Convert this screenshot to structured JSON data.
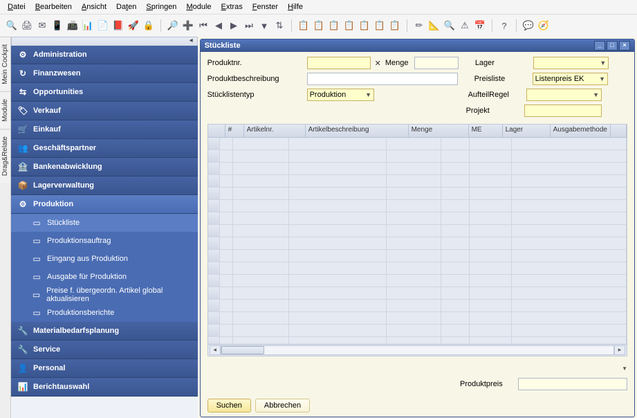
{
  "menu": [
    "Datei",
    "Bearbeiten",
    "Ansicht",
    "Daten",
    "Springen",
    "Module",
    "Extras",
    "Fenster",
    "Hilfe"
  ],
  "cockpit_tabs": [
    "Mein Cockpit",
    "Module",
    "Drag&Relate"
  ],
  "nav": [
    {
      "icon": "⚙",
      "label": "Administration"
    },
    {
      "icon": "↻",
      "label": "Finanzwesen"
    },
    {
      "icon": "⇆",
      "label": "Opportunities"
    },
    {
      "icon": "🏷",
      "label": "Verkauf"
    },
    {
      "icon": "🛒",
      "label": "Einkauf"
    },
    {
      "icon": "👥",
      "label": "Geschäftspartner"
    },
    {
      "icon": "🏦",
      "label": "Bankenabwicklung"
    },
    {
      "icon": "📦",
      "label": "Lagerverwaltung"
    },
    {
      "icon": "⚙",
      "label": "Produktion",
      "sel": true,
      "children": [
        {
          "label": "Stückliste",
          "sel": true
        },
        {
          "label": "Produktionsauftrag"
        },
        {
          "label": "Eingang aus Produktion"
        },
        {
          "label": "Ausgabe für Produktion"
        },
        {
          "label": "Preise f. übergeordn. Artikel global aktualisieren"
        },
        {
          "label": "Produktionsberichte"
        }
      ]
    },
    {
      "icon": "🔧",
      "label": "Materialbedarfsplanung"
    },
    {
      "icon": "🔧",
      "label": "Service"
    },
    {
      "icon": "👤",
      "label": "Personal"
    },
    {
      "icon": "📊",
      "label": "Berichtauswahl"
    }
  ],
  "window": {
    "title": "Stückliste",
    "fields": {
      "produktnr": {
        "label": "Produktnr.",
        "value": ""
      },
      "menge": {
        "label": "Menge",
        "value": ""
      },
      "lager": {
        "label": "Lager",
        "value": ""
      },
      "produktbeschreibung": {
        "label": "Produktbeschreibung",
        "value": ""
      },
      "preisliste": {
        "label": "Preisliste",
        "value": "Listenpreis EK"
      },
      "stuecklistentyp": {
        "label": "Stücklistentyp",
        "value": "Produktion"
      },
      "aufteilregel": {
        "label": "AufteilRegel",
        "value": ""
      },
      "projekt": {
        "label": "Projekt",
        "value": ""
      },
      "produktpreis": {
        "label": "Produktpreis",
        "value": ""
      }
    },
    "grid_cols": [
      "#",
      "Artikelnr.",
      "Artikelbeschreibung",
      "Menge",
      "ME",
      "Lager",
      "Ausgabemethode"
    ],
    "buttons": {
      "search": "Suchen",
      "cancel": "Abbrechen"
    }
  }
}
